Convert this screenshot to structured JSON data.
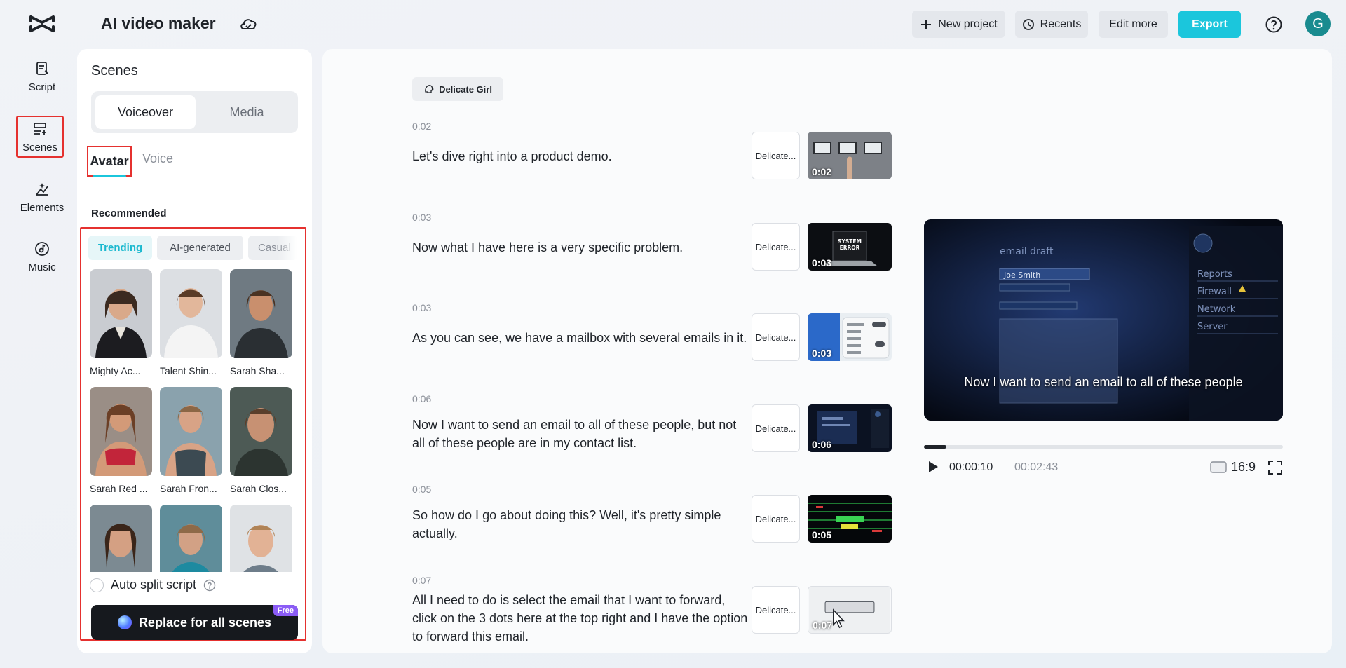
{
  "header": {
    "app_title": "AI video maker",
    "buttons": {
      "new_project": "New project",
      "recents": "Recents",
      "edit_more": "Edit more",
      "export": "Export"
    },
    "user_initial": "G"
  },
  "rail": {
    "items": [
      {
        "label": "Script",
        "icon": "script-icon"
      },
      {
        "label": "Scenes",
        "icon": "scenes-icon",
        "active": true
      },
      {
        "label": "Elements",
        "icon": "elements-icon"
      },
      {
        "label": "Music",
        "icon": "music-icon"
      }
    ]
  },
  "panel": {
    "title": "Scenes",
    "segments": {
      "voiceover": "Voiceover",
      "media": "Media"
    },
    "subtabs": {
      "avatar": "Avatar",
      "voice": "Voice"
    },
    "recommended": "Recommended",
    "chips": {
      "trending": "Trending",
      "ai_generated": "AI-generated",
      "casual": "Casual"
    },
    "avatars": [
      {
        "name": "Mighty Ac..."
      },
      {
        "name": "Talent Shin..."
      },
      {
        "name": "Sarah Sha..."
      },
      {
        "name": "Sarah Red ..."
      },
      {
        "name": "Sarah Fron..."
      },
      {
        "name": "Sarah Clos..."
      },
      {
        "name": ""
      },
      {
        "name": ""
      },
      {
        "name": ""
      }
    ],
    "auto_split": "Auto split script",
    "replace_button": "Replace for all scenes",
    "free_badge": "Free"
  },
  "main": {
    "voice_chip": "Delicate Girl",
    "scenes": [
      {
        "time": "0:02",
        "text": "Let's dive right into a product demo.",
        "voice": "Delicate...",
        "clip_duration": "0:02"
      },
      {
        "time": "0:03",
        "text": "Now what I have here is a very specific problem.",
        "voice": "Delicate...",
        "clip_duration": "0:03"
      },
      {
        "time": "0:03",
        "text": "As you can see, we have a mailbox with several emails in it.",
        "voice": "Delicate...",
        "clip_duration": "0:03"
      },
      {
        "time": "0:06",
        "text": "Now I want to send an email to all of these people, but not all of these people are in my contact list.",
        "voice": "Delicate...",
        "clip_duration": "0:06"
      },
      {
        "time": "0:05",
        "text": "So how do I go about doing this? Well, it's pretty simple actually.",
        "voice": "Delicate...",
        "clip_duration": "0:05"
      },
      {
        "time": "0:07",
        "text": "All I need to do is select the email that I want to forward, click on the 3 dots here at the top right and I have the option to forward this email.",
        "voice": "Delicate...",
        "clip_duration": "0:07"
      }
    ]
  },
  "preview": {
    "caption": "Now I want to send an email to all of these people",
    "screen_text": {
      "title": "email draft",
      "name": "Joe Smith",
      "menu": [
        "Reports",
        "Firewall",
        "Network",
        "Server"
      ]
    },
    "current_time": "00:00:10",
    "total_time": "00:02:43",
    "progress": 0.062,
    "aspect_ratio": "16:9"
  },
  "colors": {
    "accent": "#1bc6dc",
    "highlight_border": "#e5312f",
    "dark_button": "#16191e"
  }
}
